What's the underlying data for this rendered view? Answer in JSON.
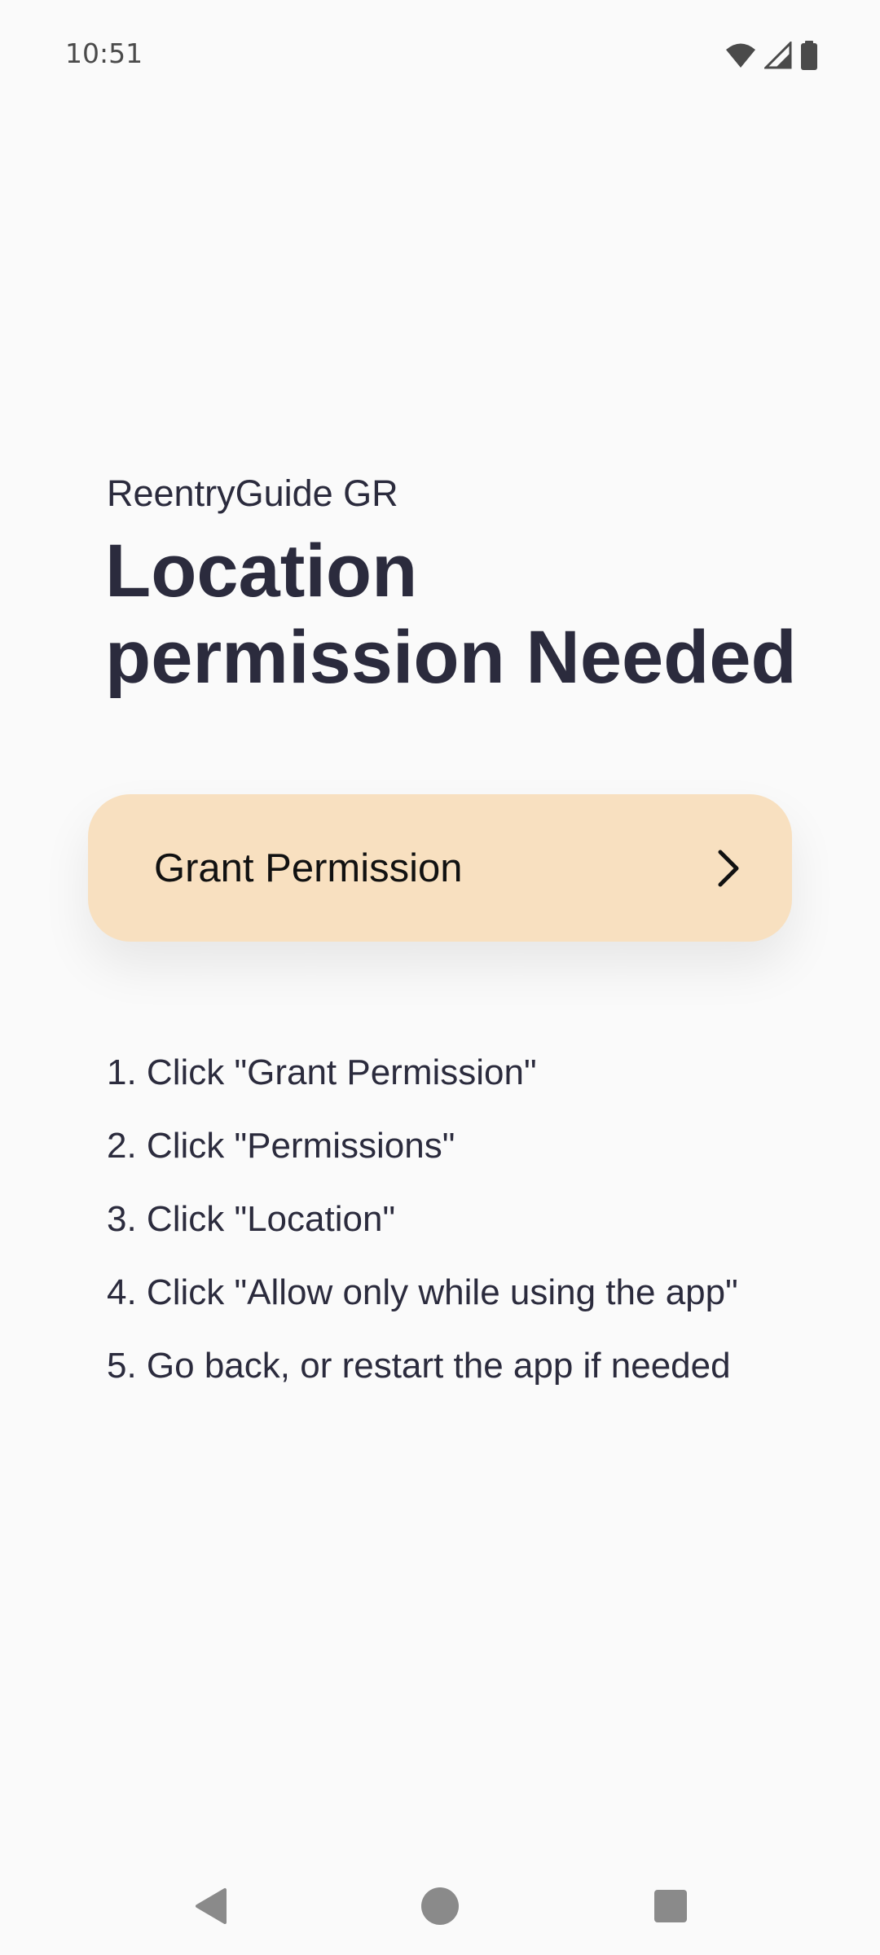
{
  "status_bar": {
    "time": "10:51",
    "icons": [
      "wifi-icon",
      "cell-signal-icon",
      "battery-icon"
    ]
  },
  "header": {
    "app_name": "ReentryGuide GR",
    "title": "Location permission Needed"
  },
  "grant_button": {
    "label": "Grant Permission",
    "icon": "chevron-right-icon",
    "background": "#f8e0c0"
  },
  "steps": [
    "1. Click \"Grant Permission\"",
    "2. Click \"Permissions\"",
    "3. Click \"Location\"",
    "4. Click \"Allow only while using the app\"",
    "5. Go back, or restart the app if needed"
  ],
  "nav_bar": {
    "icons": [
      "back-icon",
      "home-icon",
      "recents-icon"
    ]
  },
  "colors": {
    "background": "#fafafa",
    "text": "#2b2b3d",
    "button": "#f8e0c0"
  }
}
